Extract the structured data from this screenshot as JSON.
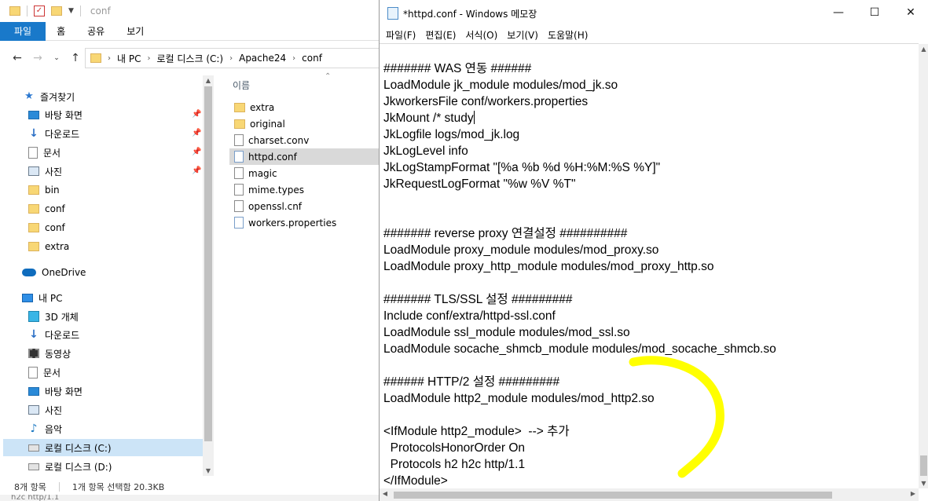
{
  "explorer": {
    "title": "conf",
    "ribbon_tabs": [
      "파일",
      "홈",
      "공유",
      "보기"
    ],
    "address": {
      "crumbs": [
        "내 PC",
        "로컬 디스크 (C:)",
        "Apache24",
        "conf"
      ]
    },
    "nav": [
      {
        "label": "즐겨찾기",
        "icon": "star-icon",
        "pinned": false
      },
      {
        "label": "바탕 화면",
        "icon": "desktop-icon",
        "pinned": true
      },
      {
        "label": "다운로드",
        "icon": "download-icon",
        "pinned": true
      },
      {
        "label": "문서",
        "icon": "document-icon",
        "pinned": true
      },
      {
        "label": "사진",
        "icon": "pictures-icon",
        "pinned": true
      },
      {
        "label": "bin",
        "icon": "folder-icon",
        "pinned": false
      },
      {
        "label": "conf",
        "icon": "folder-icon",
        "pinned": false
      },
      {
        "label": "conf",
        "icon": "folder-icon",
        "pinned": false
      },
      {
        "label": "extra",
        "icon": "folder-icon",
        "pinned": false
      },
      {
        "label": "OneDrive",
        "icon": "onedrive-icon",
        "pinned": false
      },
      {
        "label": "내 PC",
        "icon": "pc-icon",
        "pinned": false
      },
      {
        "label": "3D 개체",
        "icon": "3d-objects-icon",
        "pinned": false
      },
      {
        "label": "다운로드",
        "icon": "download-icon",
        "pinned": false
      },
      {
        "label": "동영상",
        "icon": "video-icon",
        "pinned": false
      },
      {
        "label": "문서",
        "icon": "document-icon",
        "pinned": false
      },
      {
        "label": "바탕 화면",
        "icon": "desktop-icon",
        "pinned": false
      },
      {
        "label": "사진",
        "icon": "pictures-icon",
        "pinned": false
      },
      {
        "label": "음악",
        "icon": "music-icon",
        "pinned": false
      },
      {
        "label": "로컬 디스크 (C:)",
        "icon": "drive-icon",
        "pinned": false,
        "selected": true
      },
      {
        "label": "로컬 디스크 (D:)",
        "icon": "drive-icon",
        "pinned": false
      }
    ],
    "column_header": "이름",
    "files": [
      {
        "name": "extra",
        "icon": "folder-icon"
      },
      {
        "name": "original",
        "icon": "folder-icon"
      },
      {
        "name": "charset.conv",
        "icon": "file-icon"
      },
      {
        "name": "httpd.conf",
        "icon": "config-file-icon",
        "selected": true
      },
      {
        "name": "magic",
        "icon": "file-icon"
      },
      {
        "name": "mime.types",
        "icon": "file-icon"
      },
      {
        "name": "openssl.cnf",
        "icon": "file-icon"
      },
      {
        "name": "workers.properties",
        "icon": "config-file-icon"
      }
    ],
    "status": {
      "items": "8개 항목",
      "selection": "1개 항목 선택함 20.3KB"
    },
    "underlying_text": "h2c http/1.1"
  },
  "notepad": {
    "title": "*httpd.conf - Windows 메모장",
    "menu": [
      "파일(F)",
      "편집(E)",
      "서식(O)",
      "보기(V)",
      "도움말(H)"
    ],
    "lines": [
      "####### WAS 연동 ######",
      "LoadModule jk_module modules/mod_jk.so",
      "JkworkersFile conf/workers.properties",
      "JkMount /* study",
      "JkLogfile logs/mod_jk.log",
      "JkLogLevel info",
      "JkLogStampFormat \"[%a %b %d %H:%M:%S %Y]\"",
      "JkRequestLogFormat \"%w %V %T\"",
      "",
      "",
      "####### reverse proxy 연결설정 ##########",
      "LoadModule proxy_module modules/mod_proxy.so",
      "LoadModule proxy_http_module modules/mod_proxy_http.so",
      "",
      "####### TLS/SSL 설정 #########",
      "Include conf/extra/httpd-ssl.conf",
      "LoadModule ssl_module modules/mod_ssl.so",
      "LoadModule socache_shmcb_module modules/mod_socache_shmcb.so",
      "",
      "###### HTTP/2 설정 #########",
      "LoadModule http2_module modules/mod_http2.so",
      "",
      "<IfModule http2_module>  --> 추가",
      "  ProtocolsHonorOrder On",
      "  Protocols h2 h2c http/1.1",
      "</IfModule>"
    ],
    "caret_line": 3
  },
  "colors": {
    "accent": "#1979ca",
    "annotation": "#ffff00",
    "selection": "#cce4f7"
  }
}
